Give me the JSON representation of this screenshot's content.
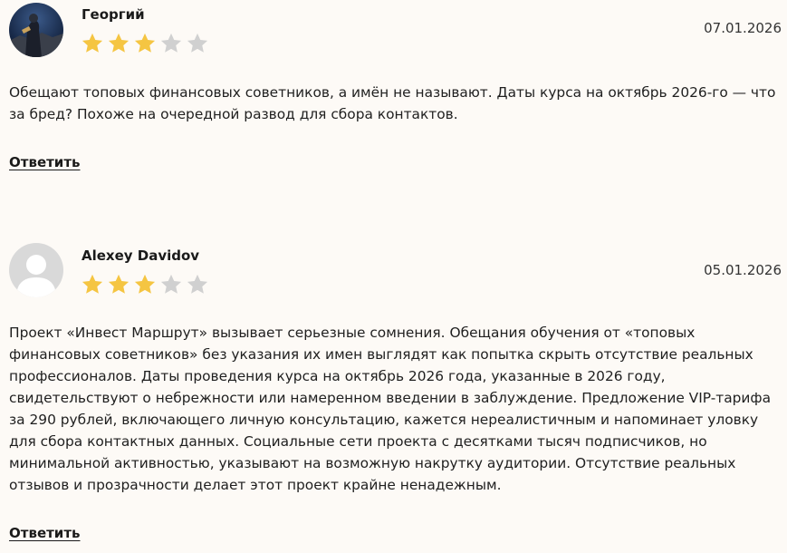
{
  "reviews": [
    {
      "author": "Георгий",
      "date": "07.01.2026",
      "rating": 3,
      "max_rating": 5,
      "avatar": "photo-avatar",
      "text": "Обещают топовых финансовых советников, а имён не называют. Даты курса на октябрь 2026-го — что за бред? Похоже на очередной развод для сбора контактов.",
      "reply_label": "Ответить"
    },
    {
      "author": "Alexey Davidov",
      "date": "05.01.2026",
      "rating": 3,
      "max_rating": 5,
      "avatar": "default-user-avatar",
      "text": "Проект «Инвест Маршрут» вызывает серьезные сомнения. Обещания обучения от «топовых финансовых советников» без указания их имен выглядят как попытка скрыть отсутствие реальных профессионалов. Даты проведения курса на октябрь 2026 года, указанные в 2026 году, свидетельствуют о небрежности или намеренном введении в заблуждение. Предложение VIP-тарифа за 290 рублей, включающего личную консультацию, кажется нереалистичным и напоминает уловку для сбора контактных данных. Социальные сети проекта с десятками тысяч подписчиков, но минимальной активностью, указывают на возможную накрутку аудитории. Отсутствие реальных отзывов и прозрачности делает этот проект крайне ненадежным.",
      "reply_label": "Ответить"
    }
  ],
  "colors": {
    "star_filled": "#f5c542",
    "star_empty": "#d0d0d0",
    "background": "#fdfaf6"
  }
}
